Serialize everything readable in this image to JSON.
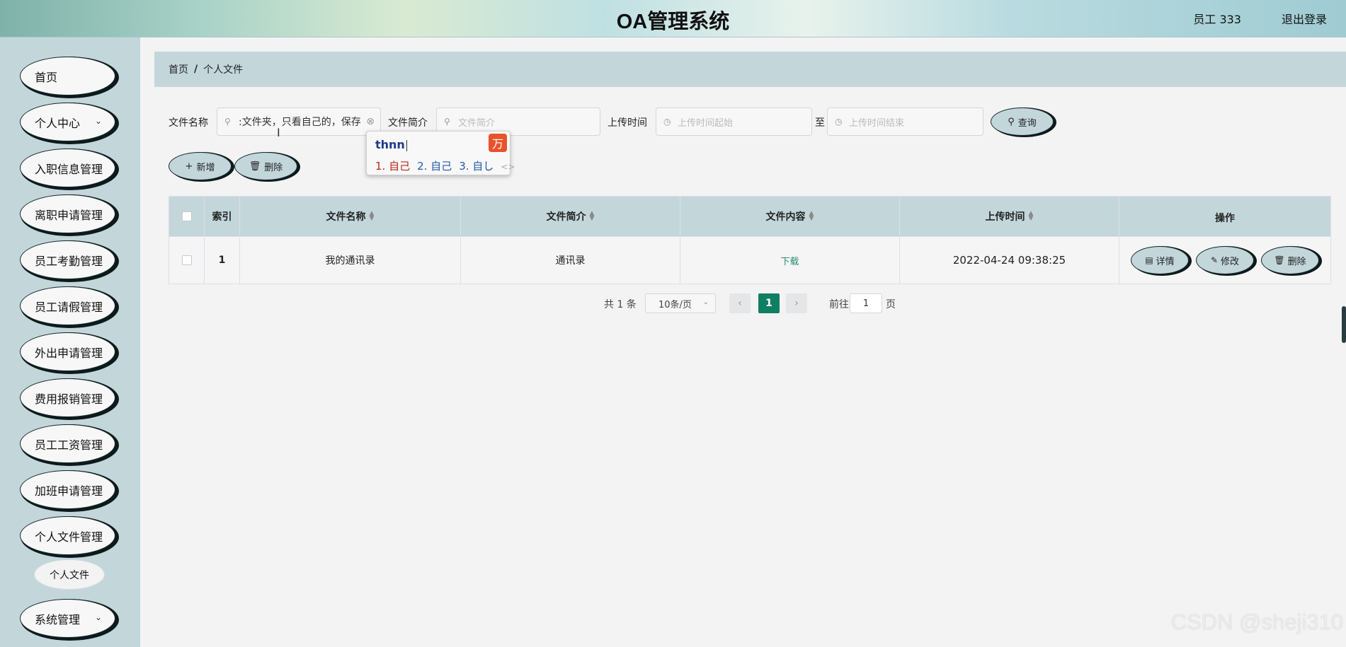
{
  "header": {
    "title": "OA管理系统",
    "user": "员工 333",
    "logout": "退出登录"
  },
  "sidebar": {
    "items": [
      {
        "label": "首页",
        "has_chevron": false
      },
      {
        "label": "个人中心",
        "has_chevron": true
      },
      {
        "label": "入职信息管理",
        "has_chevron": false
      },
      {
        "label": "离职申请管理",
        "has_chevron": false
      },
      {
        "label": "员工考勤管理",
        "has_chevron": false
      },
      {
        "label": "员工请假管理",
        "has_chevron": false
      },
      {
        "label": "外出申请管理",
        "has_chevron": false
      },
      {
        "label": "费用报销管理",
        "has_chevron": false
      },
      {
        "label": "员工工资管理",
        "has_chevron": false
      },
      {
        "label": "加班申请管理",
        "has_chevron": false
      },
      {
        "label": "个人文件管理",
        "has_chevron": false
      },
      {
        "label": "系统管理",
        "has_chevron": true
      }
    ],
    "sub_item": "个人文件",
    "chevron": "⌄"
  },
  "breadcrumb": {
    "home": "首页",
    "separator": "/",
    "current": "个人文件"
  },
  "search": {
    "name_label": "文件名称",
    "name_value": ":文件夹，只看自己的，保存",
    "intro_label": "文件简介",
    "intro_placeholder": "文件简介",
    "time_label": "上传时间",
    "time_start_placeholder": "上传时间起始",
    "to_label": "至",
    "time_end_placeholder": "上传时间结束",
    "query_button": "查询"
  },
  "ime": {
    "typed": "thnn",
    "logo": "万",
    "candidates": [
      "1. 自己",
      "2. 自己",
      "3. 自し"
    ],
    "arrows": "<>"
  },
  "actions": {
    "add": "新增",
    "delete": "删除"
  },
  "table": {
    "headers": [
      "索引",
      "文件名称",
      "文件简介",
      "文件内容",
      "上传时间",
      "操作"
    ],
    "rows": [
      {
        "index": "1",
        "name": "我的通讯录",
        "intro": "通讯录",
        "content_link": "下载",
        "time": "2022-04-24 09:38:25"
      }
    ],
    "op_buttons": [
      "详情",
      "修改",
      "删除"
    ]
  },
  "pagination": {
    "total": "共 1 条",
    "page_size": "10条/页",
    "current_page": "1",
    "goto_label": "前往",
    "goto_value": "1",
    "page_word": "页",
    "prev": "‹",
    "next": "›"
  },
  "watermark": "CSDN @sheji310",
  "colors": {
    "sidebar_bg": "#c3d7db",
    "accent_green": "#0f7f63",
    "link_green": "#2a8c72"
  }
}
